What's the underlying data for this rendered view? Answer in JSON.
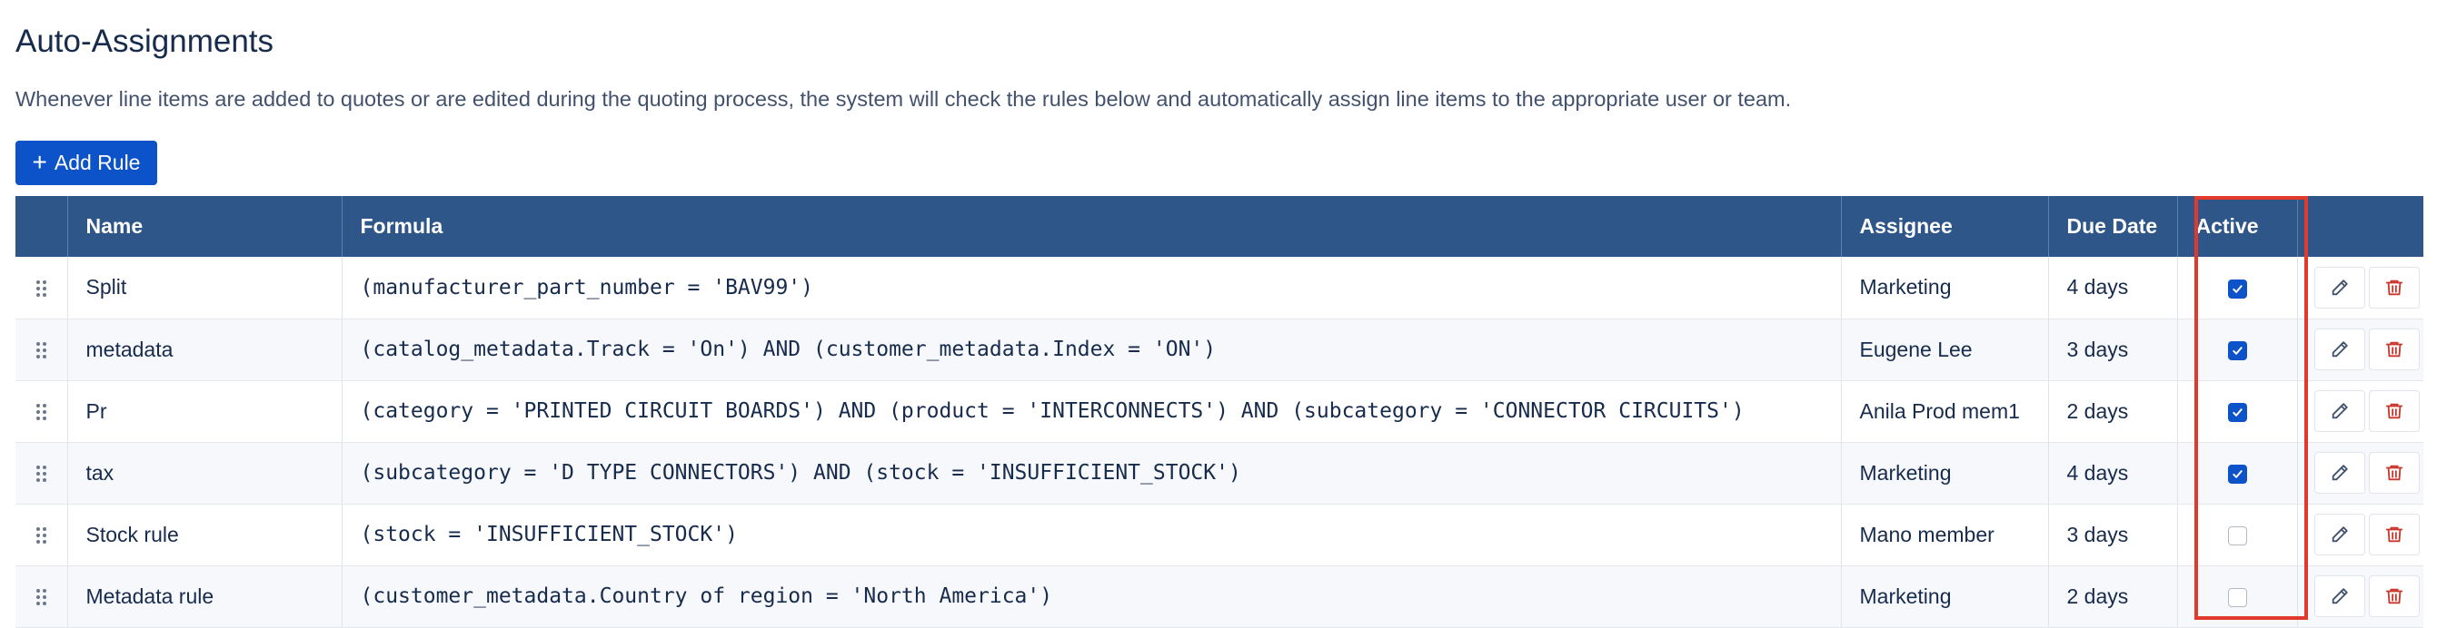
{
  "page": {
    "title": "Auto-Assignments",
    "description": "Whenever line items are added to quotes or are edited during the quoting process, the system will check the rules below and automatically assign line items to the appropriate user or team."
  },
  "toolbar": {
    "add_rule_label": "Add Rule",
    "add_rule_icon": "plus"
  },
  "table": {
    "headers": {
      "name": "Name",
      "formula": "Formula",
      "assignee": "Assignee",
      "due_date": "Due Date",
      "active": "Active"
    },
    "rows": [
      {
        "name": "Split",
        "formula": "(manufacturer_part_number = 'BAV99')",
        "assignee": "Marketing",
        "due_date": "4 days",
        "active": true
      },
      {
        "name": "metadata",
        "formula": "(catalog_metadata.Track = 'On') AND (customer_metadata.Index = 'ON')",
        "assignee": "Eugene Lee",
        "due_date": "3 days",
        "active": true
      },
      {
        "name": "Pr",
        "formula": "(category = 'PRINTED CIRCUIT BOARDS') AND (product = 'INTERCONNECTS') AND (subcategory = 'CONNECTOR CIRCUITS')",
        "assignee": "Anila Prod mem1",
        "due_date": "2 days",
        "active": true
      },
      {
        "name": "tax",
        "formula": "(subcategory = 'D TYPE CONNECTORS') AND (stock = 'INSUFFICIENT_STOCK')",
        "assignee": "Marketing",
        "due_date": "4 days",
        "active": true
      },
      {
        "name": "Stock rule",
        "formula": "(stock = 'INSUFFICIENT_STOCK')",
        "assignee": "Mano member",
        "due_date": "3 days",
        "active": false
      },
      {
        "name": "Metadata rule",
        "formula": "(customer_metadata.Country of region = 'North America')",
        "assignee": "Marketing",
        "due_date": "2 days",
        "active": false
      }
    ],
    "row_icons": {
      "handle": "drag-handle-icon",
      "edit": "pencil-icon",
      "delete": "trash-icon"
    }
  },
  "colors": {
    "primary": "#0c52c8",
    "header_bg": "#2e5688",
    "delete_icon": "#c9372c",
    "highlight": "#e1392b"
  }
}
